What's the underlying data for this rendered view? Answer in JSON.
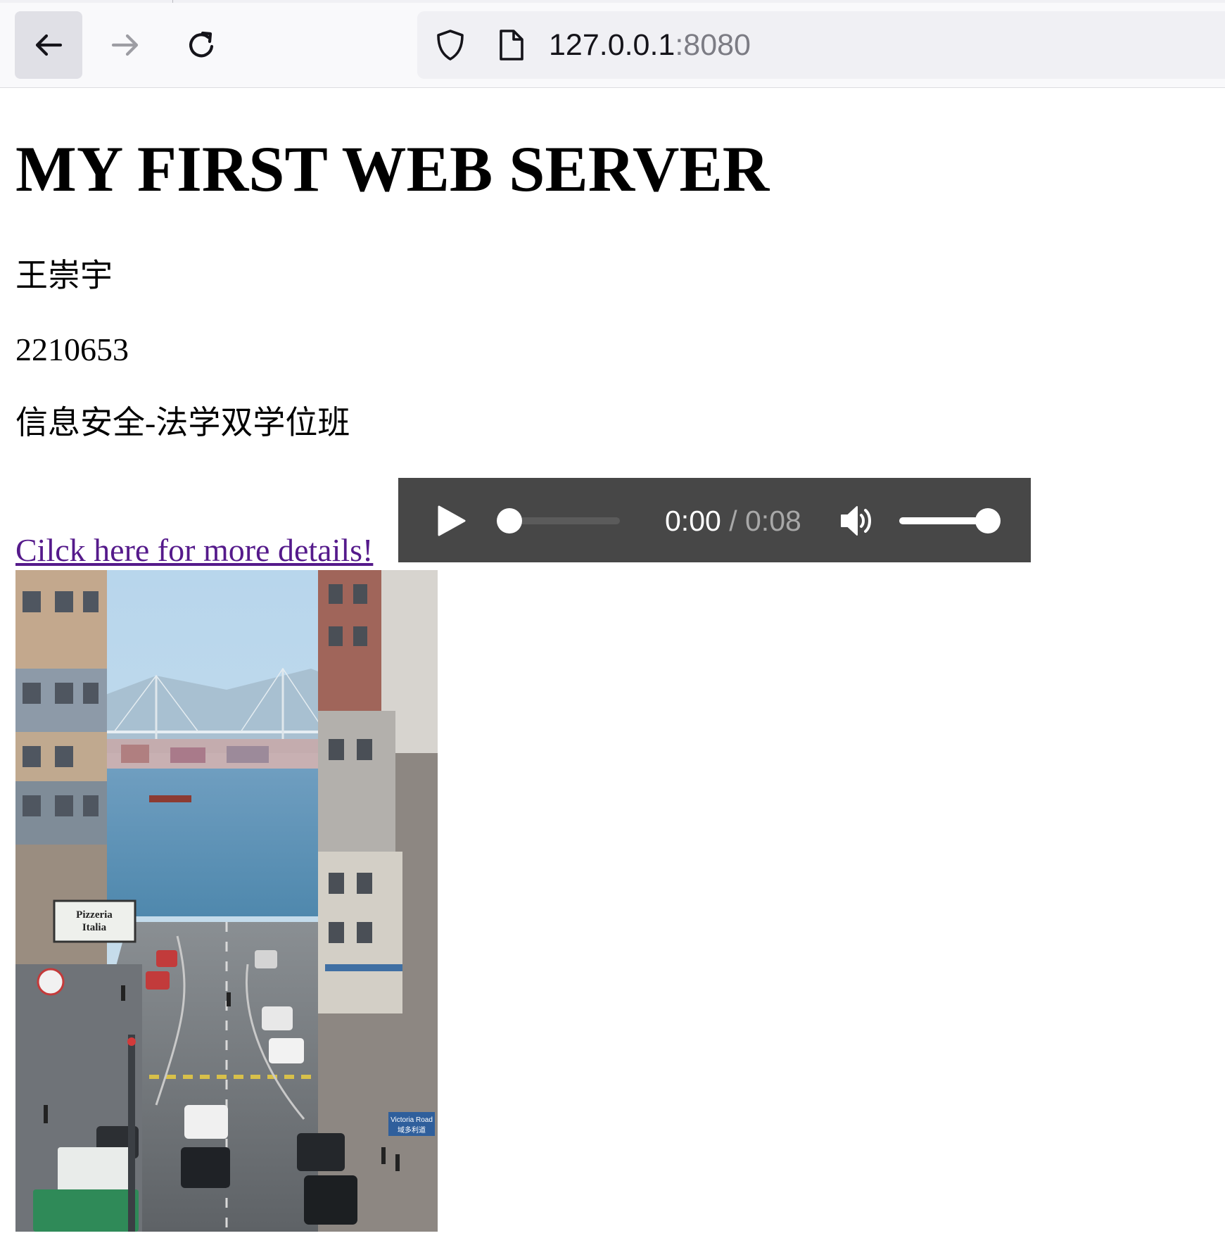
{
  "browser": {
    "url_host": "127.0.0.1",
    "url_port": ":8080",
    "icons": [
      "back-arrow-icon",
      "forward-arrow-icon",
      "reload-icon",
      "shield-icon",
      "page-icon"
    ]
  },
  "page": {
    "title": "MY FIRST WEB SERVER",
    "name": "王崇宇",
    "student_id": "2210653",
    "class_name": "信息安全-法学双学位班",
    "link_text": "Cilck here for more details!",
    "link_color": "#551a8b"
  },
  "audio": {
    "current_time": "0:00",
    "separator": " / ",
    "duration": "0:08",
    "progress": 0,
    "volume": 1.0,
    "icons": [
      "play-icon",
      "volume-icon"
    ],
    "background": "#474747"
  },
  "photo": {
    "signs": {
      "pizzeria": "Pizzeria\nItalia",
      "street_en": "Victoria Road",
      "street_zh": "域多利道"
    }
  }
}
